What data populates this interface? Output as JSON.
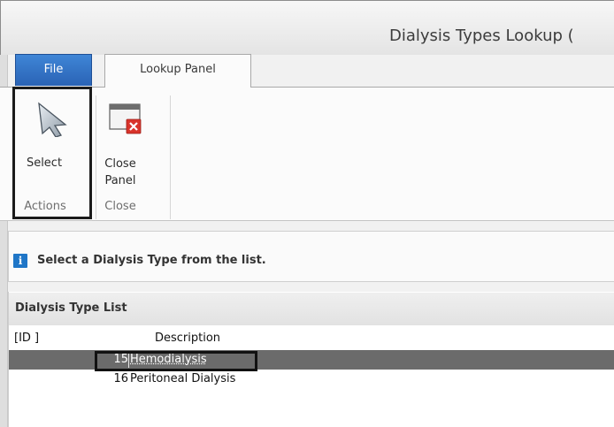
{
  "window": {
    "title": "Dialysis Types Lookup ("
  },
  "tabs": {
    "file": "File",
    "lookup_panel": "Lookup Panel"
  },
  "ribbon": {
    "actions": {
      "select_label": "Select",
      "group_label": "Actions"
    },
    "close": {
      "close_panel_line1": "Close",
      "close_panel_line2": "Panel",
      "group_label": "Close"
    }
  },
  "info": {
    "message": "Select a Dialysis Type from the list.",
    "icon": "info-icon"
  },
  "list": {
    "title": "Dialysis Type List",
    "columns": {
      "id": "[ID ]",
      "description": "Description"
    },
    "rows": [
      {
        "id": "15",
        "description": "Hemodialysis",
        "selected": true
      },
      {
        "id": "16",
        "description": "Peritoneal Dialysis",
        "selected": false
      }
    ]
  },
  "colors": {
    "file_tab": "#2a63b5",
    "selected_row": "#6b6b6b",
    "info_icon": "#1f76c7",
    "close_x": "#d9342b"
  }
}
